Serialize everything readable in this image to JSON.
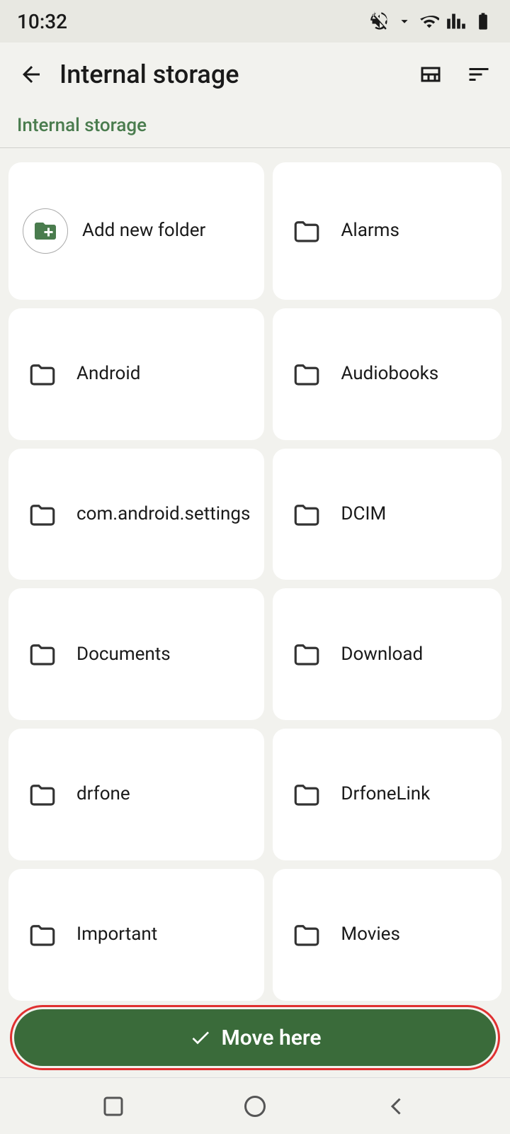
{
  "status": {
    "time": "10:32"
  },
  "app_bar": {
    "title": "Internal storage",
    "back_label": "back",
    "grid_view_label": "grid view",
    "sort_label": "sort"
  },
  "breadcrumb": {
    "text": "Internal storage"
  },
  "folders": [
    {
      "id": "add-new-folder",
      "label": "Add new folder",
      "is_add": true
    },
    {
      "id": "alarms",
      "label": "Alarms",
      "is_add": false
    },
    {
      "id": "android",
      "label": "Android",
      "is_add": false
    },
    {
      "id": "audiobooks",
      "label": "Audiobooks",
      "is_add": false
    },
    {
      "id": "com-android-settings",
      "label": "com.android.settings",
      "is_add": false
    },
    {
      "id": "dcim",
      "label": "DCIM",
      "is_add": false
    },
    {
      "id": "documents",
      "label": "Documents",
      "is_add": false
    },
    {
      "id": "download",
      "label": "Download",
      "is_add": false
    },
    {
      "id": "drfone",
      "label": "drfone",
      "is_add": false
    },
    {
      "id": "drfonelink",
      "label": "DrfoneLink",
      "is_add": false
    },
    {
      "id": "important",
      "label": "Important",
      "is_add": false
    },
    {
      "id": "movies",
      "label": "Movies",
      "is_add": false
    }
  ],
  "move_here": {
    "label": "Move here",
    "check_icon": "✓"
  },
  "nav": {
    "square_label": "recent apps",
    "circle_label": "home",
    "triangle_label": "back"
  }
}
